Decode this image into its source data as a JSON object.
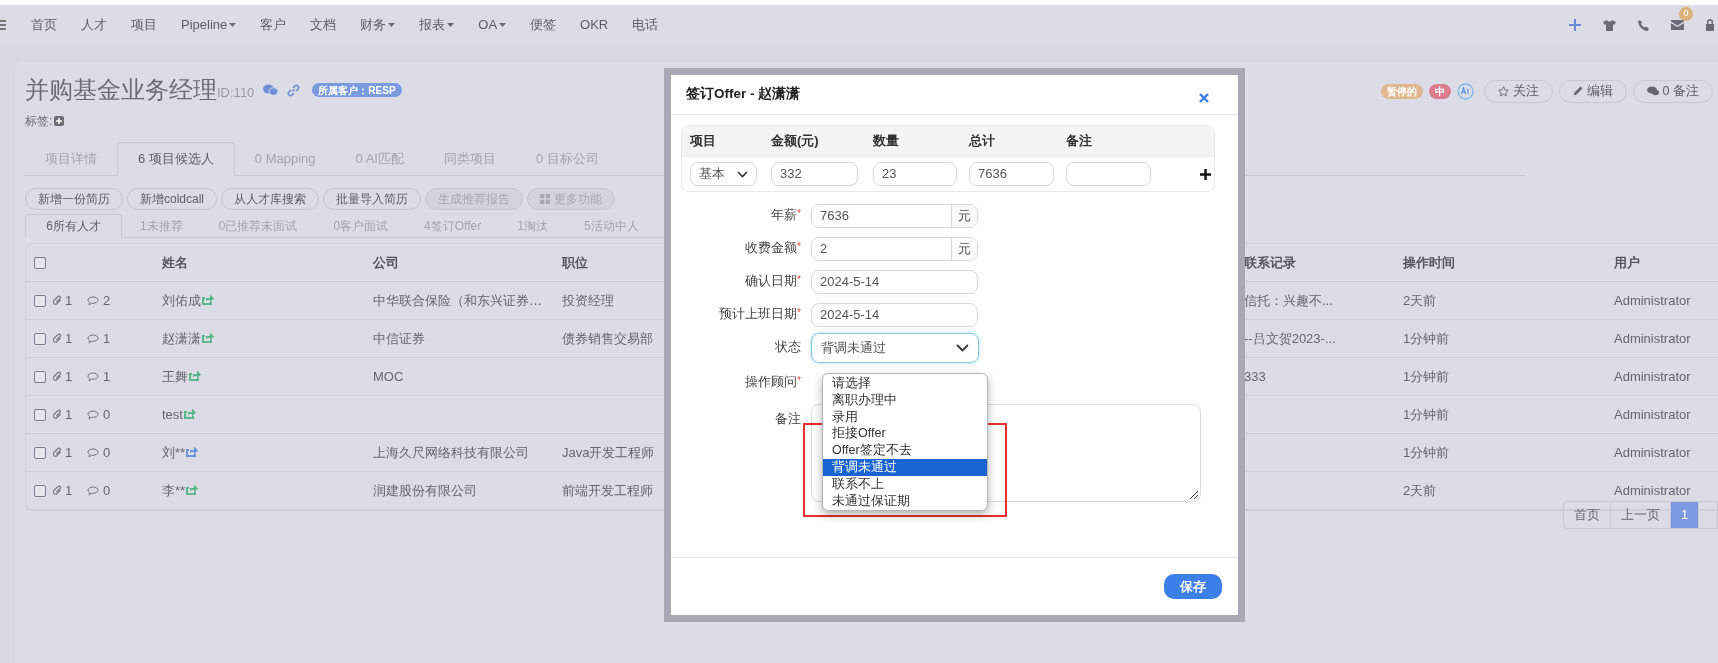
{
  "nav": {
    "items": [
      {
        "label": "首页",
        "dropdown": false
      },
      {
        "label": "人才",
        "dropdown": false
      },
      {
        "label": "项目",
        "dropdown": false
      },
      {
        "label": "Pipeline",
        "dropdown": true
      },
      {
        "label": "客户",
        "dropdown": false
      },
      {
        "label": "文档",
        "dropdown": false
      },
      {
        "label": "财务",
        "dropdown": true
      },
      {
        "label": "报表",
        "dropdown": true
      },
      {
        "label": "OA",
        "dropdown": true
      },
      {
        "label": "便签",
        "dropdown": false
      },
      {
        "label": "OKR",
        "dropdown": false
      },
      {
        "label": "电话",
        "dropdown": false
      }
    ],
    "mail_badge": "0"
  },
  "project": {
    "title": "并购基金业务经理",
    "id": "ID:110",
    "client_badge": "所属客户：RESP",
    "tags_label": "标签:",
    "status_badges": [
      {
        "label": "暂停的",
        "color": "#e1b78f"
      },
      {
        "label": "中",
        "color": "#db7d8c"
      }
    ],
    "actions": [
      {
        "kind": "star",
        "label": "关注"
      },
      {
        "kind": "edit",
        "label": "编辑"
      },
      {
        "kind": "comment",
        "label": "0 备注"
      }
    ]
  },
  "tabs": [
    {
      "label": "项目详情",
      "selected": false
    },
    {
      "label": "6 项目候选人",
      "selected": true
    },
    {
      "label": "0 Mapping",
      "selected": false
    },
    {
      "label": "0 AI匹配",
      "selected": false
    },
    {
      "label": "同类项目",
      "selected": false
    },
    {
      "label": "0 目标公司",
      "selected": false
    }
  ],
  "toolbar": [
    {
      "kind": "plain",
      "label": "新增一份简历",
      "disabled": false
    },
    {
      "kind": "plain",
      "label": "新增coldcall",
      "disabled": false
    },
    {
      "kind": "plain",
      "label": "从人才库搜索",
      "disabled": false
    },
    {
      "kind": "plain",
      "label": "批量导入简历",
      "disabled": false
    },
    {
      "kind": "plain",
      "label": "生成推荐报告",
      "disabled": true
    },
    {
      "kind": "more",
      "label": "更多功能",
      "disabled": true
    }
  ],
  "subtabs": [
    {
      "label": "6所有人才",
      "selected": true
    },
    {
      "label": "1未推荐",
      "selected": false
    },
    {
      "label": "0已推荐未面试",
      "selected": false
    },
    {
      "label": "0客户面试",
      "selected": false
    },
    {
      "label": "4签订Offer",
      "selected": false
    },
    {
      "label": "1淘汰",
      "selected": false
    },
    {
      "label": "5活动中人",
      "selected": false
    }
  ],
  "table": {
    "select_all_checked": false,
    "columns": [
      "姓名",
      "公司",
      "职位",
      "联系记录",
      "操作时间",
      "用户"
    ],
    "rows": [
      {
        "checked": false,
        "attachments": "1",
        "comments": "2",
        "name": "刘佑成",
        "color": "#5cb88a",
        "company": "中华联合保险（和东兴证券…",
        "position": "投资经理",
        "contact": "信托：兴趣不...",
        "time": "2天前",
        "user": "Administrator"
      },
      {
        "checked": false,
        "attachments": "1",
        "comments": "1",
        "name": "赵潇潇",
        "color": "#5cb88a",
        "company": "中信证券",
        "position": "债券销售交易部",
        "contact": "--吕文贺2023-...",
        "time": "1分钟前",
        "user": "Administrator"
      },
      {
        "checked": false,
        "attachments": "1",
        "comments": "1",
        "name": "王舞",
        "color": "#5cb88a",
        "company": "MOC",
        "contact": "333",
        "time": "1分钟前",
        "user": "Administrator"
      },
      {
        "checked": false,
        "attachments": "1",
        "comments": "0",
        "name": "test",
        "color": "#5cb88a",
        "time": "1分钟前",
        "user": "Administrator"
      },
      {
        "checked": false,
        "attachments": "1",
        "comments": "0",
        "name": "刘**",
        "color": "#6f95e0",
        "company": "上海久尺网络科技有限公司",
        "position": "Java开发工程师",
        "time": "1分钟前",
        "user": "Administrator"
      },
      {
        "checked": false,
        "attachments": "1",
        "comments": "0",
        "name": "李**",
        "color": "#5cb88a",
        "company": "润建股份有限公司",
        "position": "前端开发工程师",
        "time": "2天前",
        "user": "Administrator"
      }
    ]
  },
  "pagination": [
    {
      "label": "首页",
      "selected": false
    },
    {
      "label": "上一页",
      "selected": false
    },
    {
      "label": "1",
      "selected": true
    }
  ],
  "modal": {
    "title": "签订Offer - 赵潇潇",
    "fee_table": {
      "columns": [
        "项目",
        "金额(元)",
        "数量",
        "总计",
        "备注"
      ],
      "row": {
        "item": "基本",
        "amount": "332",
        "quantity": "23",
        "total": "7636"
      }
    },
    "fields": [
      {
        "kind": "text",
        "label": "年薪",
        "required_mark": "*",
        "value": "7636",
        "unit": "元"
      },
      {
        "kind": "text",
        "label": "收费金额",
        "required_mark": "*",
        "value": "2",
        "unit": "元"
      },
      {
        "kind": "text",
        "label": "确认日期",
        "required_mark": "*",
        "value": "2024-5-14"
      },
      {
        "kind": "text",
        "label": "预计上班日期",
        "required_mark": "*",
        "value": "2024-5-14"
      },
      {
        "kind": "select",
        "label": "状态",
        "value": "背调未通过",
        "open": true
      },
      {
        "kind": "covered",
        "label": "操作顾问",
        "required_mark": "*"
      },
      {
        "kind": "textarea",
        "label": "备注"
      }
    ],
    "options": [
      {
        "label": "请选择",
        "selected": false
      },
      {
        "label": "离职办理中",
        "selected": false
      },
      {
        "label": "录用",
        "selected": false
      },
      {
        "label": "拒接Offer",
        "selected": false
      },
      {
        "label": "Offer签定不去",
        "selected": false
      },
      {
        "label": "背调未通过",
        "selected": true
      },
      {
        "label": "联系不上",
        "selected": false
      },
      {
        "label": "未通过保证期",
        "selected": false
      }
    ],
    "save": "保存"
  }
}
